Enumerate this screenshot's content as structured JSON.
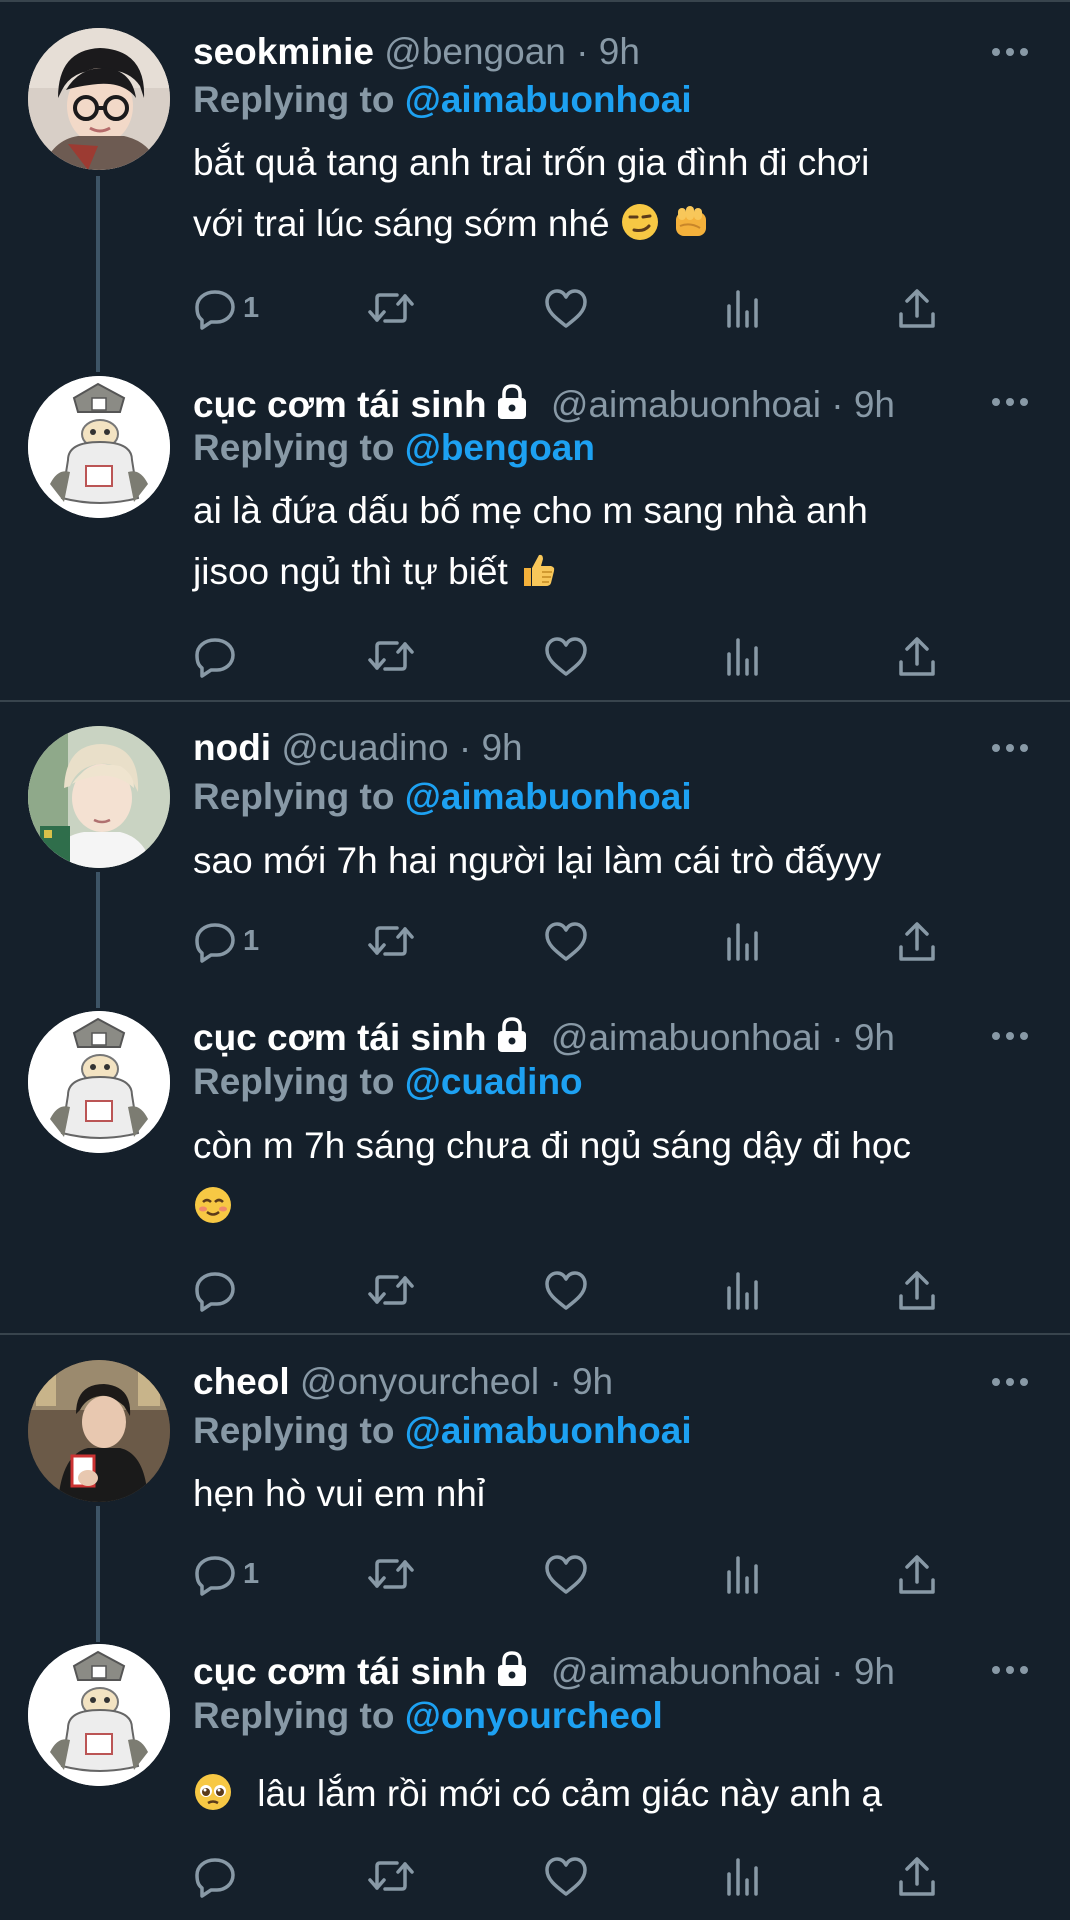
{
  "tweets": [
    {
      "name": "seokminie",
      "handle": "@bengoan",
      "dot": "·",
      "time": "9h",
      "replying_prefix": "Replying to",
      "replying_to": "@aimabuonhoai",
      "text_line1": "bắt quả tang anh trai trốn gia đình đi chơi",
      "text_line2": "với trai lúc sáng sớm nhé",
      "emojis": [
        "smirk-emoji",
        "fist-emoji"
      ],
      "reply_count": "1"
    },
    {
      "name": "cục cơm tái sinh",
      "protected": true,
      "handle": "@aimabuonhoai",
      "dot": "·",
      "time": "9h",
      "replying_prefix": "Replying to",
      "replying_to": "@bengoan",
      "text_line1": "ai là đứa dấu bố mẹ cho m sang nhà anh",
      "text_line2": "jisoo ngủ thì tự biết",
      "emojis": [
        "thumbs-up-emoji"
      ],
      "reply_count": ""
    },
    {
      "name": "nodi",
      "handle": "@cuadino",
      "dot": "·",
      "time": "9h",
      "replying_prefix": "Replying to",
      "replying_to": "@aimabuonhoai",
      "text_line1": "sao mới 7h hai người lại làm cái trò đấyyy",
      "reply_count": "1"
    },
    {
      "name": "cục cơm tái sinh",
      "protected": true,
      "handle": "@aimabuonhoai",
      "dot": "·",
      "time": "9h",
      "replying_prefix": "Replying to",
      "replying_to": "@cuadino",
      "text_line1": "còn m 7h sáng chưa đi ngủ sáng dậy đi học",
      "emojis": [
        "smiling-blush-emoji"
      ],
      "reply_count": ""
    },
    {
      "name": "cheol",
      "handle": "@onyourcheol",
      "dot": "·",
      "time": "9h",
      "replying_prefix": "Replying to",
      "replying_to": "@aimabuonhoai",
      "text_line1": "hẹn hò vui em nhỉ",
      "reply_count": "1"
    },
    {
      "name": "cục cơm tái sinh",
      "protected": true,
      "handle": "@aimabuonhoai",
      "dot": "·",
      "time": "9h",
      "replying_prefix": "Replying to",
      "replying_to": "@onyourcheol",
      "text_line1": "lâu lắm rồi mới có cảm giác này anh ạ",
      "emojis": [
        "pleading-face-emoji"
      ],
      "reply_count": ""
    }
  ],
  "colors": {
    "background": "#15202b",
    "secondary_text": "#8899a6",
    "link": "#1da1f2",
    "separator": "#38444d",
    "thread_line": "#3d5466"
  },
  "icons": [
    "reply-icon",
    "retweet-icon",
    "like-icon",
    "analytics-icon",
    "share-icon",
    "more-icon",
    "lock-icon"
  ]
}
